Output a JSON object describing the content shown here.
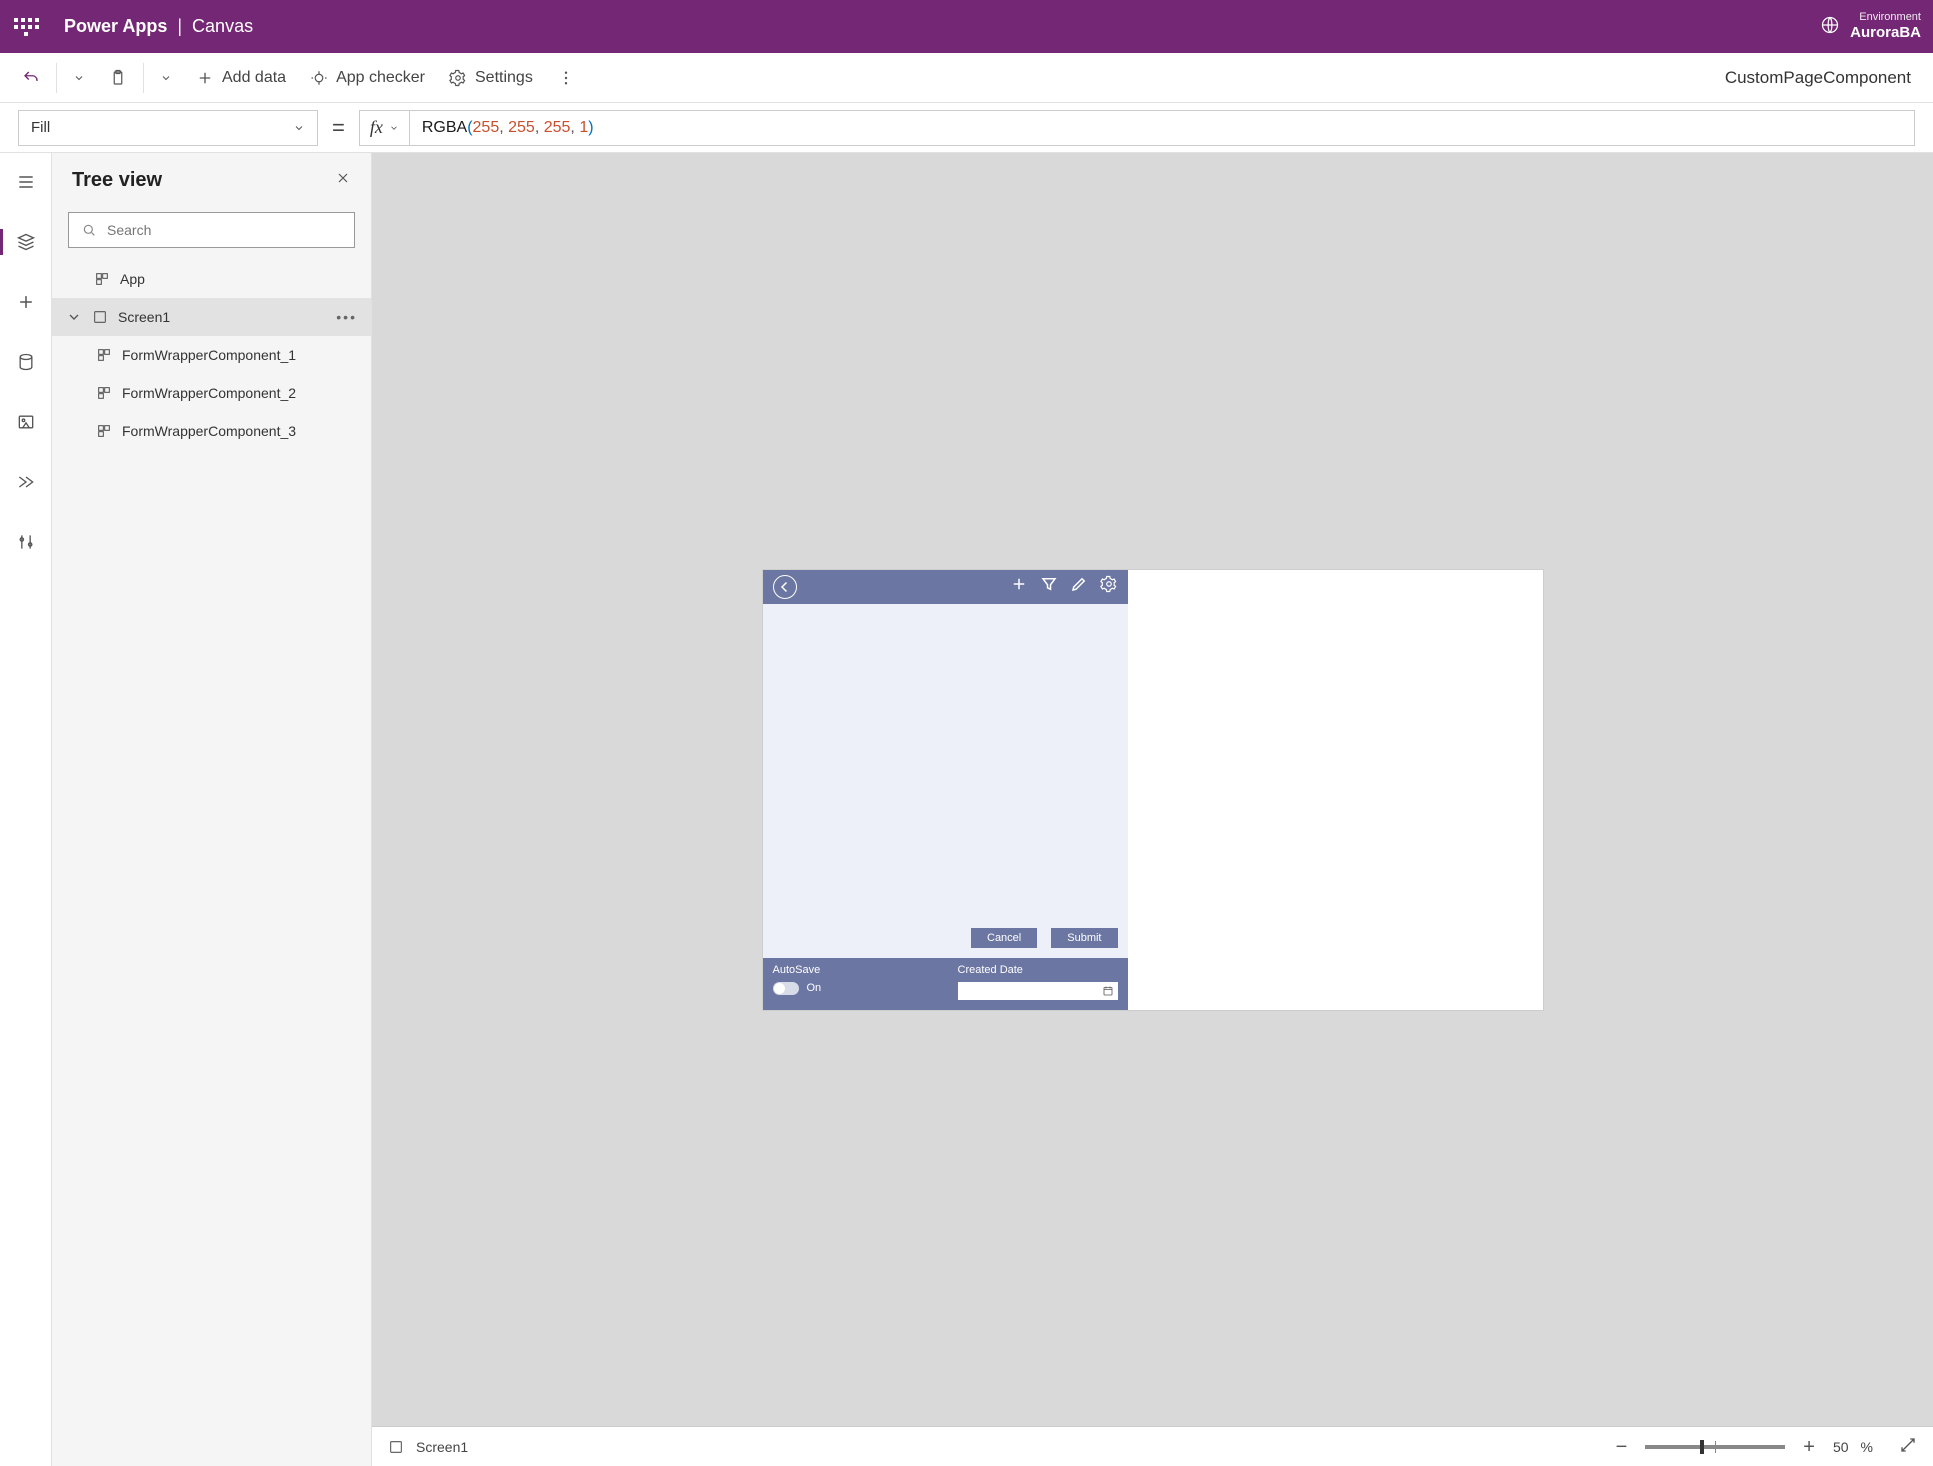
{
  "header": {
    "product": "Power Apps",
    "separator": "|",
    "context": "Canvas",
    "env_label": "Environment",
    "env_name": "AuroraBA"
  },
  "cmdbar": {
    "add_data": "Add data",
    "app_checker": "App checker",
    "settings": "Settings",
    "app_name": "CustomPageComponent"
  },
  "formula": {
    "property": "Fill",
    "fx": "fx",
    "fn": "RGBA",
    "args": [
      "255",
      "255",
      "255",
      "1"
    ]
  },
  "tree": {
    "title": "Tree view",
    "search_placeholder": "Search",
    "app_label": "App",
    "screen_label": "Screen1",
    "children": [
      "FormWrapperComponent_1",
      "FormWrapperComponent_2",
      "FormWrapperComponent_3"
    ]
  },
  "canvas": {
    "cancel": "Cancel",
    "submit": "Submit",
    "autosave_label": "AutoSave",
    "autosave_state": "On",
    "created_label": "Created Date"
  },
  "status": {
    "screen": "Screen1",
    "zoom_value": "50",
    "zoom_pct": "%"
  }
}
